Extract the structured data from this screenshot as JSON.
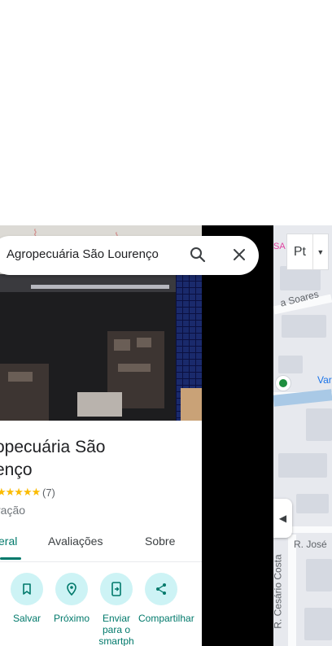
{
  "search": {
    "query": "Agropecuária São Lourenço"
  },
  "language_selector": {
    "label": "Pt"
  },
  "place": {
    "title_line1": "opecuária São",
    "title_line2": "enço",
    "stars": "★★★★★",
    "rating_count": "(7)",
    "category": "ração"
  },
  "tabs": [
    {
      "label": "eral",
      "active": true
    },
    {
      "label": "Avaliações",
      "active": false
    },
    {
      "label": "Sobre",
      "active": false
    }
  ],
  "actions": [
    {
      "label": "Salvar",
      "icon": "bookmark-icon"
    },
    {
      "label": "Próximo",
      "icon": "nearby-icon"
    },
    {
      "label": "Enviar para o smartph",
      "icon": "send-to-phone-icon"
    },
    {
      "label": "Compartilhar",
      "icon": "share-icon"
    }
  ],
  "map": {
    "labels": {
      "soares": "a Soares",
      "var": "Var",
      "jose": "R. José",
      "cesario": "R. Cesário Costa",
      "sa": "SA"
    }
  },
  "colors": {
    "accent": "#00796b",
    "action_bg": "#cdf3f5",
    "star": "#fbbc04",
    "pin": "#1e8e3e"
  }
}
